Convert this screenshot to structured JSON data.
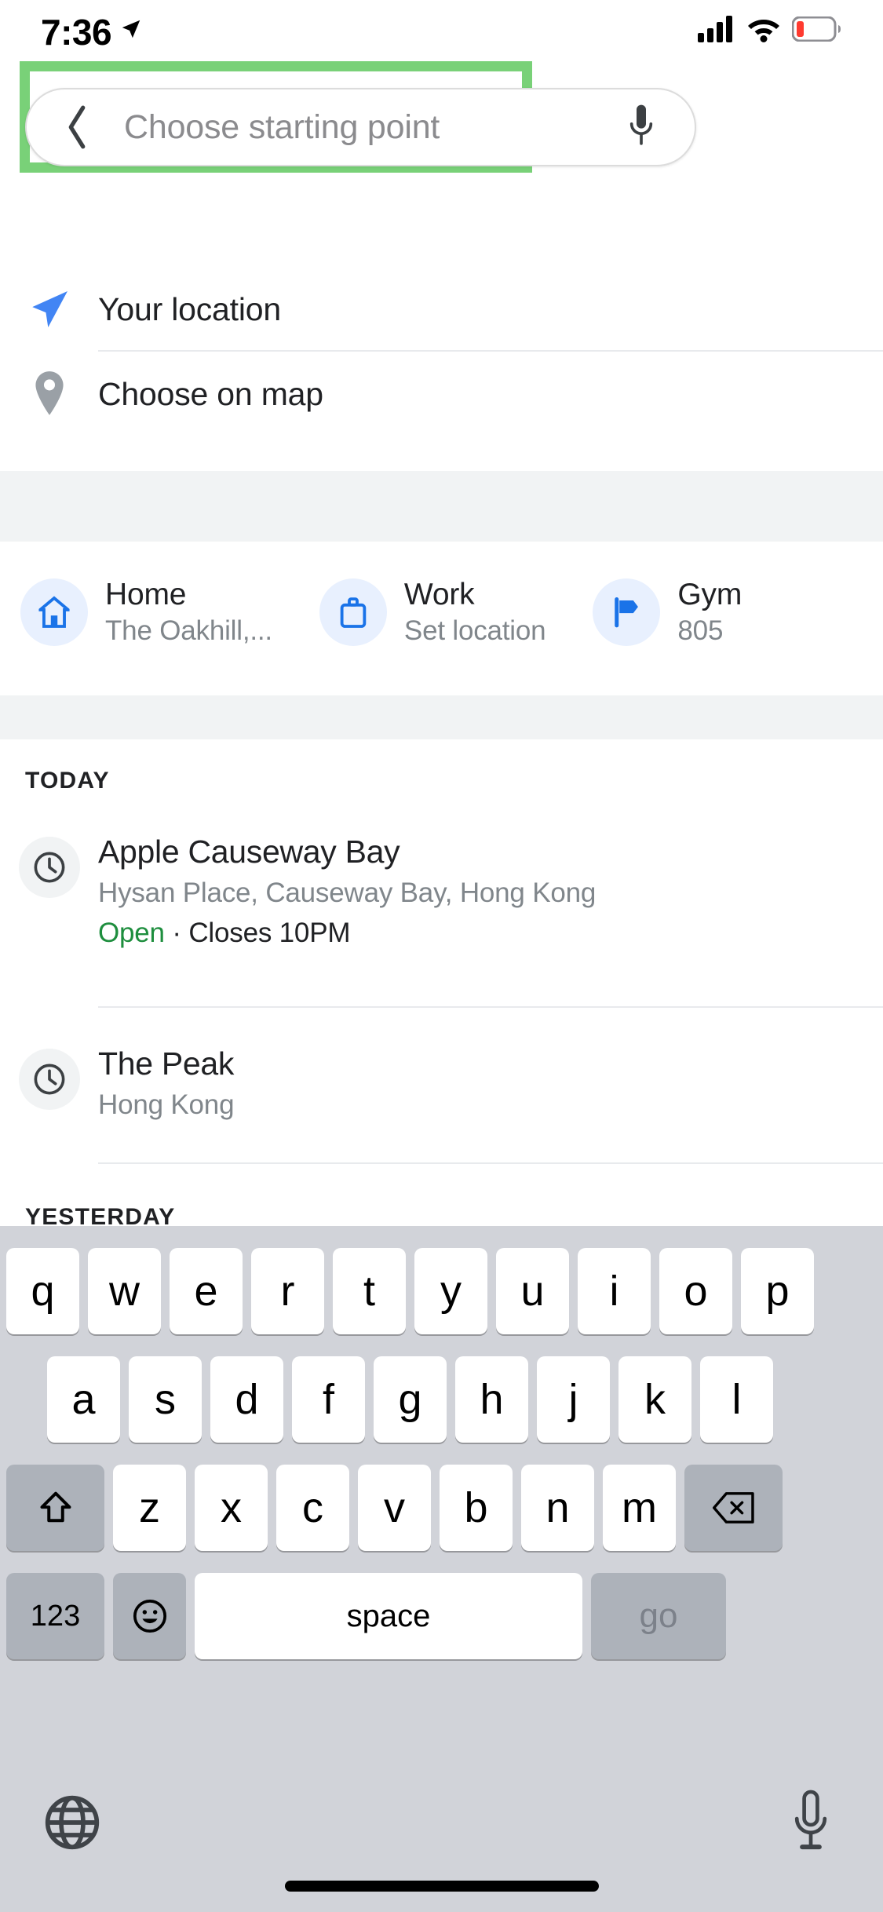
{
  "status_bar": {
    "time": "7:36",
    "location_arrow_icon": "location-arrow-icon",
    "cellular_icon": "cellular-bars-icon",
    "wifi_icon": "wifi-icon",
    "battery_icon": "battery-low-icon"
  },
  "search": {
    "placeholder": "Choose starting point",
    "value": "",
    "back_icon": "chevron-left-icon",
    "mic_icon": "microphone-icon",
    "highlight_color": "#79d178"
  },
  "options": [
    {
      "label": "Your location",
      "icon": "navigation-arrow-icon",
      "color": "#4285f4"
    },
    {
      "label": "Choose on map",
      "icon": "map-pin-icon",
      "color": "#9aa0a6"
    }
  ],
  "shortcuts": [
    {
      "title": "Home",
      "subtitle": "The Oakhill,...",
      "icon": "home-icon"
    },
    {
      "title": "Work",
      "subtitle": "Set location",
      "icon": "briefcase-icon"
    },
    {
      "title": "Gym",
      "subtitle": "805",
      "icon": "flag-icon"
    }
  ],
  "history": {
    "sections": [
      {
        "header": "TODAY",
        "items": [
          {
            "icon": "clock-icon",
            "title": "Apple Causeway Bay",
            "subtitle": "Hysan Place, Causeway Bay, Hong Kong",
            "status_open": "Open",
            "status_sep": "·",
            "status_close": "Closes 10PM"
          },
          {
            "icon": "clock-icon",
            "title": "The Peak",
            "subtitle": "Hong Kong",
            "status_open": "",
            "status_sep": "",
            "status_close": ""
          }
        ]
      },
      {
        "header": "YESTERDAY",
        "items": []
      }
    ]
  },
  "keyboard": {
    "row1": [
      "q",
      "w",
      "e",
      "r",
      "t",
      "y",
      "u",
      "i",
      "o",
      "p"
    ],
    "row2": [
      "a",
      "s",
      "d",
      "f",
      "g",
      "h",
      "j",
      "k",
      "l"
    ],
    "row3": [
      "z",
      "x",
      "c",
      "v",
      "b",
      "n",
      "m"
    ],
    "shift_icon": "shift-arrow-icon",
    "backspace_icon": "backspace-icon",
    "numbers_label": "123",
    "emoji_icon": "emoji-smiley-icon",
    "space_label": "space",
    "go_label": "go",
    "globe_icon": "globe-icon",
    "dictation_icon": "microphone-icon"
  }
}
